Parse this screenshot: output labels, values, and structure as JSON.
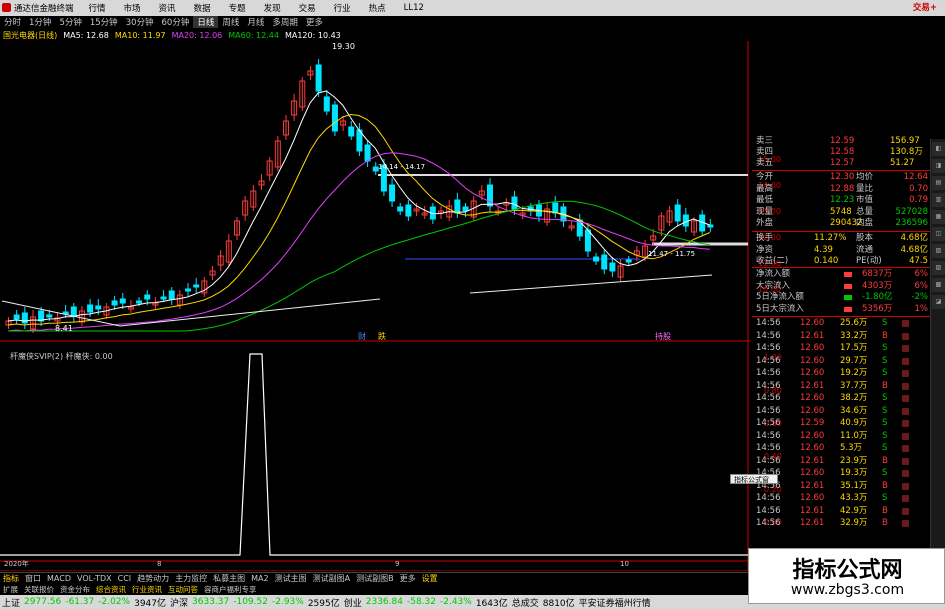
{
  "window": {
    "app_title": "通达信金融终端",
    "menus": [
      "行情",
      "市场",
      "资讯",
      "数据",
      "专题",
      "发现",
      "交易",
      "行业",
      "热点",
      "LL12"
    ],
    "brand": "交易+"
  },
  "periods": [
    "分时",
    "1分钟",
    "5分钟",
    "15分钟",
    "30分钟",
    "60分钟",
    "日线",
    "周线",
    "月线",
    "多周期",
    "更多"
  ],
  "active_period": "日线",
  "ma_bar": {
    "stock": "国光电器(日线)",
    "items": [
      {
        "label": "MA5: 12.68",
        "color": "#ffffff"
      },
      {
        "label": "MA10: 11.97",
        "color": "#ffd800"
      },
      {
        "label": "MA20: 12.06",
        "color": "#e040fb"
      },
      {
        "label": "MA60: 12.44",
        "color": "#00c800"
      },
      {
        "label": "MA120: 10.43",
        "color": "#ffffff"
      }
    ]
  },
  "chart_labels": {
    "high": "19.30",
    "low": "8.41",
    "mid": "14.14 - 14.17",
    "range2": "11.47 - 11.75",
    "event1": "财",
    "event2": "跌",
    "event3": "持股",
    "indicator_title": "杆魔侠SVIP(2)  杆魔侠: 0.00",
    "date_left": "2020年",
    "date_mid": "8",
    "date_mid2": "9",
    "date_right": "10"
  },
  "chart_data": {
    "type": "candlestick",
    "y_axis": [
      "15.00",
      "14.00",
      "13.00",
      "12.00",
      "11.00",
      "10.00"
    ],
    "indicator_axis": [
      "1.00",
      "0.80",
      "0.60",
      "0.40",
      "0.20",
      "0.00"
    ]
  },
  "quote": {
    "order_book": [
      {
        "label": "卖三",
        "price": "12.59",
        "vol": "156.97"
      },
      {
        "label": "卖四",
        "price": "12.58",
        "vol": "130.8万"
      },
      {
        "label": "卖五",
        "price": "12.57",
        "vol": "51.27"
      }
    ],
    "stats": [
      {
        "l1": "今开",
        "v1": "12.30",
        "l2": "均价",
        "v2": "12.64"
      },
      {
        "l1": "最高",
        "v1": "12.88",
        "l2": "量比",
        "v2": "0.70"
      },
      {
        "l1": "最低",
        "v1": "12.23",
        "l2": "市值",
        "v2": "0.79"
      },
      {
        "l1": "现量",
        "v1": "5748",
        "l2": "总量",
        "v2": "527028"
      },
      {
        "l1": "外盘",
        "v1": "290432",
        "l2": "内盘",
        "v2": "236596"
      }
    ],
    "stats2": [
      {
        "l1": "换手",
        "v1": "11.27%",
        "l2": "股本",
        "v2": "4.68亿"
      },
      {
        "l1": "净资",
        "v1": "4.39",
        "l2": "流通",
        "v2": "4.68亿"
      },
      {
        "l1": "收益(二)",
        "v1": "0.140",
        "l2": "PE(动)",
        "v2": "47.5"
      }
    ],
    "flows": [
      {
        "label": "净流入额",
        "value": "6837万",
        "pct": "6%",
        "color": "#ff3b3b"
      },
      {
        "label": "大宗流入",
        "value": "4303万",
        "pct": "6%",
        "color": "#ff3b3b"
      },
      {
        "label": "5日净流入额",
        "value": "-1.80亿",
        "pct": "-2%",
        "color": "#00c800"
      },
      {
        "label": "5日大宗流入",
        "value": "5356万",
        "pct": "1%",
        "color": "#ff3b3b"
      }
    ],
    "ticks": [
      {
        "t": "14:56",
        "p": "12.60",
        "v": "25.6万",
        "s": "S"
      },
      {
        "t": "14:56",
        "p": "12.61",
        "v": "33.2万",
        "s": "B"
      },
      {
        "t": "14:56",
        "p": "12.60",
        "v": "17.5万",
        "s": "S"
      },
      {
        "t": "14:56",
        "p": "12.60",
        "v": "29.7万",
        "s": "S"
      },
      {
        "t": "14:56",
        "p": "12.60",
        "v": "19.2万",
        "s": "S"
      },
      {
        "t": "14:56",
        "p": "12.61",
        "v": "37.7万",
        "s": "B"
      },
      {
        "t": "14:56",
        "p": "12.60",
        "v": "38.2万",
        "s": "S"
      },
      {
        "t": "14:56",
        "p": "12.60",
        "v": "34.6万",
        "s": "S"
      },
      {
        "t": "14:56",
        "p": "12.59",
        "v": "40.9万",
        "s": "S"
      },
      {
        "t": "14:56",
        "p": "12.60",
        "v": "11.0万",
        "s": "S"
      },
      {
        "t": "14:56",
        "p": "12.60",
        "v": "5.3万",
        "s": "S"
      },
      {
        "t": "14:56",
        "p": "12.61",
        "v": "23.9万",
        "s": "B"
      },
      {
        "t": "14:56",
        "p": "12.60",
        "v": "19.3万",
        "s": "S"
      },
      {
        "t": "14:56",
        "p": "12.61",
        "v": "35.1万",
        "s": "B"
      },
      {
        "t": "14:56",
        "p": "12.60",
        "v": "43.3万",
        "s": "S"
      },
      {
        "t": "14:56",
        "p": "12.61",
        "v": "42.9万",
        "s": "B"
      },
      {
        "t": "14:56",
        "p": "12.61",
        "v": "32.9万",
        "s": "B"
      }
    ]
  },
  "popup": "指标公式窗",
  "bottom_tabs": [
    "指标",
    "窗口",
    "MACD",
    "VOL-TDX",
    "CCI",
    "趋势动力",
    "主力监控",
    "私募主图",
    "MA2",
    "测试主图",
    "测试副图A",
    "测试副图B",
    "更多",
    "设置"
  ],
  "sub_tabs": [
    "扩展",
    "关联报价",
    "资金分布",
    "综合资讯",
    "行业资讯",
    "互动问答",
    "容商户福利专享"
  ],
  "status": [
    {
      "label": "上证",
      "val": "2977.56",
      "chg": "-61.37",
      "pct": "-2.02%",
      "amt": "3947亿"
    },
    {
      "label": "沪深",
      "val": "3633.37",
      "chg": "-109.52",
      "pct": "-2.93%",
      "amt": "2595亿"
    },
    {
      "label": "创业",
      "val": "2336.84",
      "chg": "-58.32",
      "pct": "-2.43%",
      "amt": "1643亿"
    }
  ],
  "status_total": {
    "label": "总成交",
    "amt": "8810亿",
    "broker": "平安证券福州行情"
  },
  "watermark": {
    "line1": "指标公式网",
    "line2": "www.zbgs3.com"
  }
}
